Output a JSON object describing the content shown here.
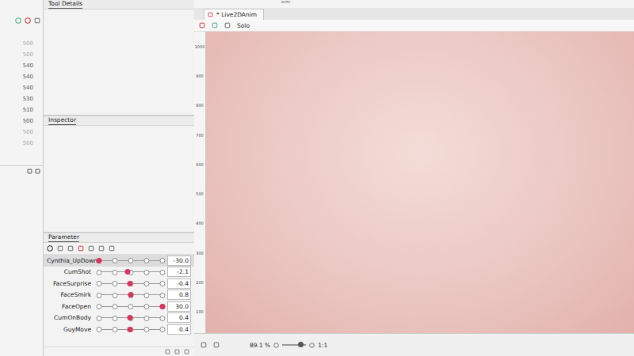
{
  "toolbar": {
    "auto": "AUTO"
  },
  "left_list": [
    {
      "text": "500",
      "dim": true
    },
    {
      "text": "500",
      "dim": true
    },
    {
      "text": "540",
      "dim": false
    },
    {
      "text": "540",
      "dim": false
    },
    {
      "text": "540",
      "dim": false
    },
    {
      "text": "530",
      "dim": false
    },
    {
      "text": "510",
      "dim": false
    },
    {
      "text": "500",
      "dim": false
    },
    {
      "text": "500",
      "dim": true
    },
    {
      "text": "500",
      "dim": true
    }
  ],
  "panels": {
    "tool_details": "Tool Details",
    "inspector": "Inspector",
    "parameter": "Parameter"
  },
  "parameters": [
    {
      "name": "Cynthia_UpDown",
      "value": "-30.0",
      "level": 0,
      "selected": true
    },
    {
      "name": "CumShot",
      "value": "-2.1",
      "level": 0.45,
      "selected": false
    },
    {
      "name": "FaceSurprise",
      "value": "-0.4",
      "level": 0.49,
      "selected": false
    },
    {
      "name": "FaceSmirk",
      "value": "0.8",
      "level": 0.5,
      "selected": false
    },
    {
      "name": "FaceOpen",
      "value": "30.0",
      "level": 1,
      "selected": false
    },
    {
      "name": "CumOnBody",
      "value": "0.4",
      "level": 0.49,
      "selected": false
    },
    {
      "name": "GuyMove",
      "value": "0.4",
      "level": 0.49,
      "selected": false
    }
  ],
  "canvas": {
    "tab": "* Live2DAnim",
    "solo": "Solo",
    "ruler": [
      "1000",
      "900",
      "800",
      "700",
      "600",
      "500",
      "400",
      "300",
      "200",
      "100"
    ]
  },
  "status_bar": {
    "zoom": "89.1 %",
    "ratio": "1:1"
  }
}
